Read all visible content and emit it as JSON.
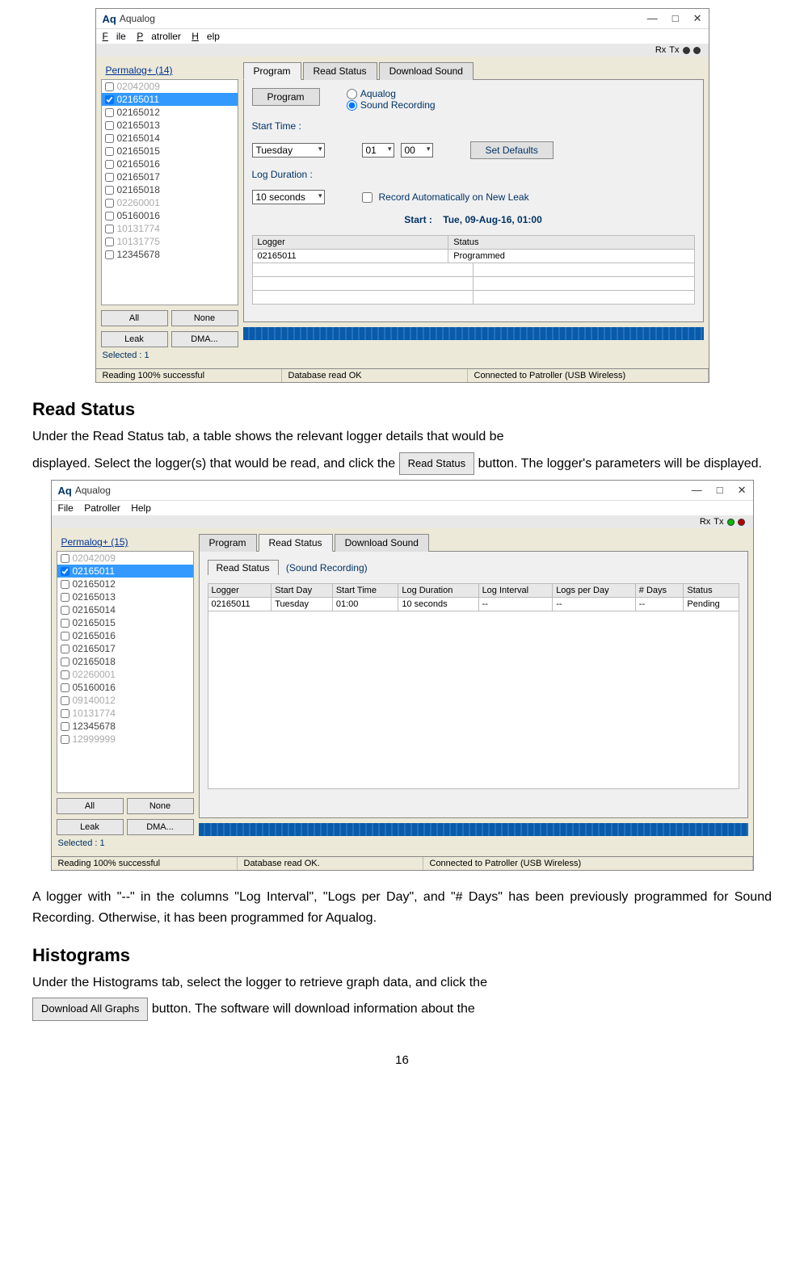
{
  "window1": {
    "logo": "Aq",
    "title": "Aqualog",
    "menus": [
      "File",
      "Patroller",
      "Help"
    ],
    "rx_label": "Rx",
    "tx_label": "Tx",
    "perma_link": "Permalog+ (14)",
    "loggers": [
      {
        "id": "02042009",
        "gray": true,
        "checked": false
      },
      {
        "id": "02165011",
        "gray": false,
        "checked": true,
        "selected": true
      },
      {
        "id": "02165012",
        "gray": false,
        "checked": false
      },
      {
        "id": "02165013",
        "gray": false,
        "checked": false
      },
      {
        "id": "02165014",
        "gray": false,
        "checked": false
      },
      {
        "id": "02165015",
        "gray": false,
        "checked": false
      },
      {
        "id": "02165016",
        "gray": false,
        "checked": false
      },
      {
        "id": "02165017",
        "gray": false,
        "checked": false
      },
      {
        "id": "02165018",
        "gray": false,
        "checked": false
      },
      {
        "id": "02260001",
        "gray": true,
        "checked": false
      },
      {
        "id": "05160016",
        "gray": false,
        "checked": false
      },
      {
        "id": "10131774",
        "gray": true,
        "checked": false
      },
      {
        "id": "10131775",
        "gray": true,
        "checked": false
      },
      {
        "id": "12345678",
        "gray": false,
        "checked": false
      }
    ],
    "btn_all": "All",
    "btn_none": "None",
    "btn_leak": "Leak",
    "btn_dma": "DMA...",
    "selected_label": "Selected : 1",
    "tabs": [
      "Program",
      "Read Status",
      "Download Sound"
    ],
    "active_tab": 0,
    "program_btn": "Program",
    "radio_aqualog": "Aqualog",
    "radio_sound": "Sound Recording",
    "start_time_label": "Start Time :",
    "day_value": "Tuesday",
    "hour_value": "01",
    "minute_value": "00",
    "set_defaults": "Set Defaults",
    "log_duration_label": "Log Duration :",
    "duration_value": "10 seconds",
    "record_auto": "Record Automatically on New Leak",
    "start_prefix": "Start :",
    "start_time": "Tue, 09-Aug-16, 01:00",
    "table_headers": [
      "Logger",
      "Status"
    ],
    "table_rows": [
      [
        "02165011",
        "Programmed"
      ]
    ],
    "status_reading": "Reading 100% successful",
    "status_db": "Database read OK",
    "status_conn": "Connected to Patroller (USB Wireless)"
  },
  "section1": {
    "heading": "Read Status",
    "para1": "Under the Read Status tab, a table shows the relevant logger details that would be",
    "para2_a": "displayed. Select the logger(s) that would be read, and click the ",
    "read_status_btn": "Read Status",
    "para2_b": " button. The logger's parameters will be displayed."
  },
  "window2": {
    "logo": "Aq",
    "title": "Aqualog",
    "menus": [
      "File",
      "Patroller",
      "Help"
    ],
    "rx_label": "Rx",
    "tx_label": "Tx",
    "perma_link": "Permalog+ (15)",
    "loggers": [
      {
        "id": "02042009",
        "gray": true,
        "checked": false
      },
      {
        "id": "02165011",
        "gray": false,
        "checked": true,
        "selected": true
      },
      {
        "id": "02165012",
        "gray": false,
        "checked": false
      },
      {
        "id": "02165013",
        "gray": false,
        "checked": false
      },
      {
        "id": "02165014",
        "gray": false,
        "checked": false
      },
      {
        "id": "02165015",
        "gray": false,
        "checked": false
      },
      {
        "id": "02165016",
        "gray": false,
        "checked": false
      },
      {
        "id": "02165017",
        "gray": false,
        "checked": false
      },
      {
        "id": "02165018",
        "gray": false,
        "checked": false
      },
      {
        "id": "02260001",
        "gray": true,
        "checked": false
      },
      {
        "id": "05160016",
        "gray": false,
        "checked": false
      },
      {
        "id": "09140012",
        "gray": true,
        "checked": false
      },
      {
        "id": "10131774",
        "gray": true,
        "checked": false
      },
      {
        "id": "12345678",
        "gray": false,
        "checked": false
      },
      {
        "id": "12999999",
        "gray": true,
        "checked": false
      }
    ],
    "btn_all": "All",
    "btn_none": "None",
    "btn_leak": "Leak",
    "btn_dma": "DMA...",
    "selected_label": "Selected : 1",
    "tabs": [
      "Program",
      "Read Status",
      "Download Sound"
    ],
    "active_tab": 1,
    "sub_tab": "Read Status",
    "sub_tab_suffix": "(Sound Recording)",
    "table_headers": [
      "Logger",
      "Start Day",
      "Start Time",
      "Log Duration",
      "Log Interval",
      "Logs per Day",
      "# Days",
      "Status"
    ],
    "table_rows": [
      [
        "02165011",
        "Tuesday",
        "01:00",
        "10 seconds",
        "--",
        "--",
        "--",
        "Pending"
      ]
    ],
    "status_reading": "Reading 100% successful",
    "status_db": "Database read OK.",
    "status_conn": "Connected to Patroller (USB Wireless)"
  },
  "section2": {
    "para": "A logger with \"--\" in the columns \"Log Interval\", \"Logs per Day\", and \"# Days\" has been previously programmed for Sound Recording. Otherwise, it has been programmed for Aqualog."
  },
  "section3": {
    "heading": "Histograms",
    "para1": "Under the Histograms tab, select the logger to retrieve graph data, and click the",
    "download_btn": "Download All Graphs",
    "para2": "button. The software will download information about the"
  },
  "page_number": "16"
}
